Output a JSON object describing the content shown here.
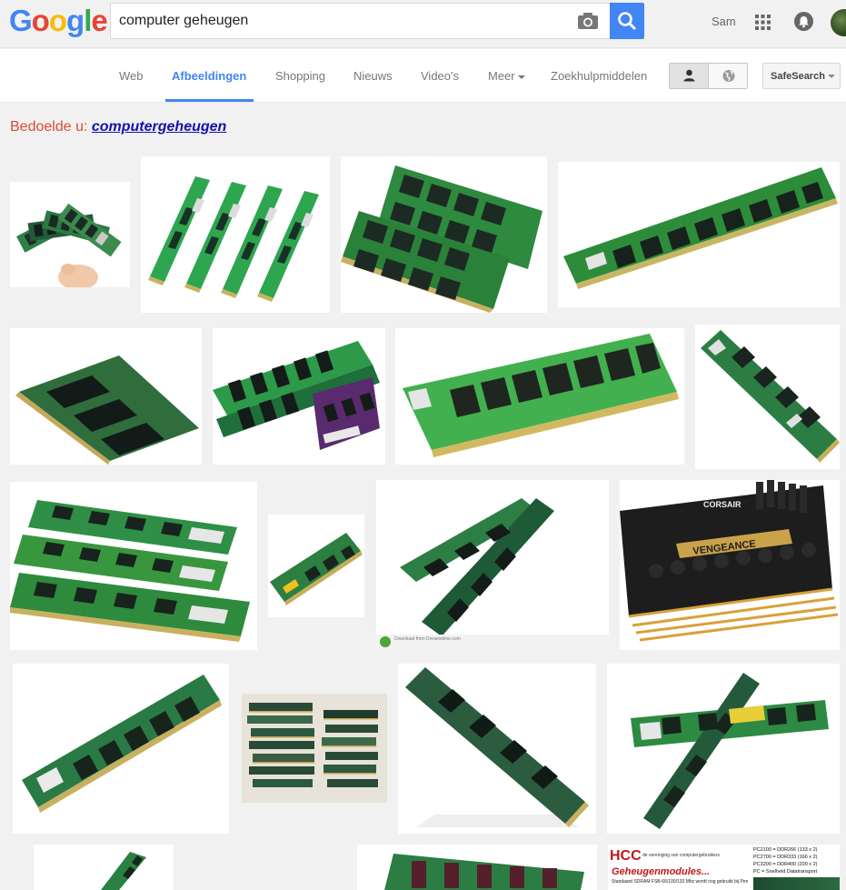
{
  "header": {
    "logo_letters": [
      "G",
      "o",
      "o",
      "g",
      "l",
      "e"
    ],
    "logo_colors": [
      "#4285f4",
      "#ea4335",
      "#fbbc05",
      "#4285f4",
      "#34a853",
      "#ea4335"
    ],
    "search_value": "computer geheugen",
    "user_name": "Sam"
  },
  "nav": {
    "tabs": [
      {
        "label": "Web"
      },
      {
        "label": "Afbeeldingen"
      },
      {
        "label": "Shopping"
      },
      {
        "label": "Nieuws"
      },
      {
        "label": "Video's"
      },
      {
        "label": "Meer"
      },
      {
        "label": "Zoekhulpmiddelen"
      }
    ],
    "active_tab": "Afbeeldingen",
    "safesearch_label": "SafeSearch"
  },
  "did_you_mean": {
    "prefix": "Bedoelde u:",
    "suggestion": "computergeheugen"
  },
  "results": {
    "description": "image results grid — computer memory modules",
    "watermark_texts": [
      "Download from Dreamstime.com",
      "CORSAIR",
      "VENGEANCE"
    ],
    "hcc_tile": {
      "brand": "HCC",
      "tagline": "de vereniging van computergebruikers",
      "title": "Geheugenmodules...",
      "lines": [
        "PC2100 = DDR266 (133 x 2)",
        "PC2700 = DDR333 (166 x 2)",
        "PC3200 = DDR400 (200 x 2)",
        "PC = Snelheid Datatransport"
      ],
      "text_line": "Standaard SDRAM FSB-66/100/133 Mhz  wordt nog gebruikt bij Pentium III en de oudere Athlon (Thunderbird) moederbor..."
    }
  },
  "colors": {
    "accent": "#4285f4",
    "dym_red": "#dd4b39",
    "link": "#1a0dab",
    "pcb_green": "#2e8b3a",
    "chip_dark": "#1e2b24"
  }
}
